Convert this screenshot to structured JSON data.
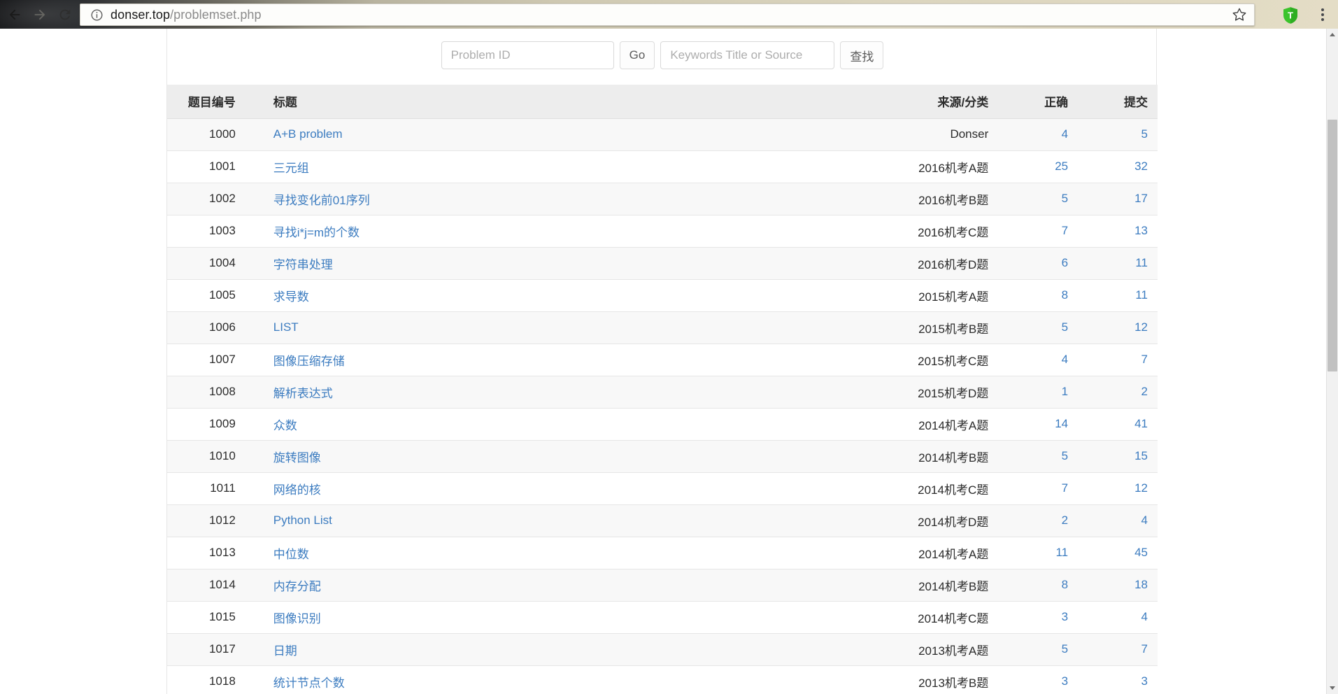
{
  "browser": {
    "back_icon": "back-arrow-icon",
    "forward_icon": "forward-arrow-icon",
    "reload_icon": "reload-icon",
    "info_icon": "info-circle-icon",
    "url_domain": "donser.top",
    "url_path": "/problemset.php",
    "star_icon": "bookmark-star-icon",
    "extension_icon": "shield-extension-icon",
    "extension_letter": "T",
    "menu_icon": "three-dot-menu-icon"
  },
  "search": {
    "problem_id_placeholder": "Problem ID",
    "problem_id_value": "",
    "go_label": "Go",
    "keywords_placeholder": "Keywords Title or Source",
    "keywords_value": "",
    "find_label": "查找"
  },
  "table": {
    "headers": {
      "id": "题目编号",
      "title": "标题",
      "source": "来源/分类",
      "accepted": "正确",
      "submitted": "提交"
    },
    "rows": [
      {
        "id": "1000",
        "title": "A+B problem",
        "source": "Donser",
        "accepted": "4",
        "submitted": "5"
      },
      {
        "id": "1001",
        "title": "三元组",
        "source": "2016机考A题",
        "accepted": "25",
        "submitted": "32"
      },
      {
        "id": "1002",
        "title": "寻找变化前01序列",
        "source": "2016机考B题",
        "accepted": "5",
        "submitted": "17"
      },
      {
        "id": "1003",
        "title": "寻找i*j=m的个数",
        "source": "2016机考C题",
        "accepted": "7",
        "submitted": "13"
      },
      {
        "id": "1004",
        "title": "字符串处理",
        "source": "2016机考D题",
        "accepted": "6",
        "submitted": "11"
      },
      {
        "id": "1005",
        "title": "求导数",
        "source": "2015机考A题",
        "accepted": "8",
        "submitted": "11"
      },
      {
        "id": "1006",
        "title": "LIST",
        "source": "2015机考B题",
        "accepted": "5",
        "submitted": "12"
      },
      {
        "id": "1007",
        "title": "图像压缩存储",
        "source": "2015机考C题",
        "accepted": "4",
        "submitted": "7"
      },
      {
        "id": "1008",
        "title": "解析表达式",
        "source": "2015机考D题",
        "accepted": "1",
        "submitted": "2"
      },
      {
        "id": "1009",
        "title": "众数",
        "source": "2014机考A题",
        "accepted": "14",
        "submitted": "41"
      },
      {
        "id": "1010",
        "title": "旋转图像",
        "source": "2014机考B题",
        "accepted": "5",
        "submitted": "15"
      },
      {
        "id": "1011",
        "title": "网络的核",
        "source": "2014机考C题",
        "accepted": "7",
        "submitted": "12"
      },
      {
        "id": "1012",
        "title": "Python List",
        "source": "2014机考D题",
        "accepted": "2",
        "submitted": "4"
      },
      {
        "id": "1013",
        "title": "中位数",
        "source": "2014机考A题",
        "accepted": "11",
        "submitted": "45"
      },
      {
        "id": "1014",
        "title": "内存分配",
        "source": "2014机考B题",
        "accepted": "8",
        "submitted": "18"
      },
      {
        "id": "1015",
        "title": "图像识别",
        "source": "2014机考C题",
        "accepted": "3",
        "submitted": "4"
      },
      {
        "id": "1017",
        "title": "日期",
        "source": "2013机考A题",
        "accepted": "5",
        "submitted": "7"
      },
      {
        "id": "1018",
        "title": "统计节点个数",
        "source": "2013机考B题",
        "accepted": "3",
        "submitted": "3"
      }
    ]
  },
  "scrollbar": {
    "up_arrow": "scroll-up-arrow-icon",
    "down_arrow": "scroll-down-arrow-icon"
  },
  "colors": {
    "link": "#3c7cc0",
    "header_bg": "#ededed",
    "row_stripe": "#f8f8f8"
  }
}
